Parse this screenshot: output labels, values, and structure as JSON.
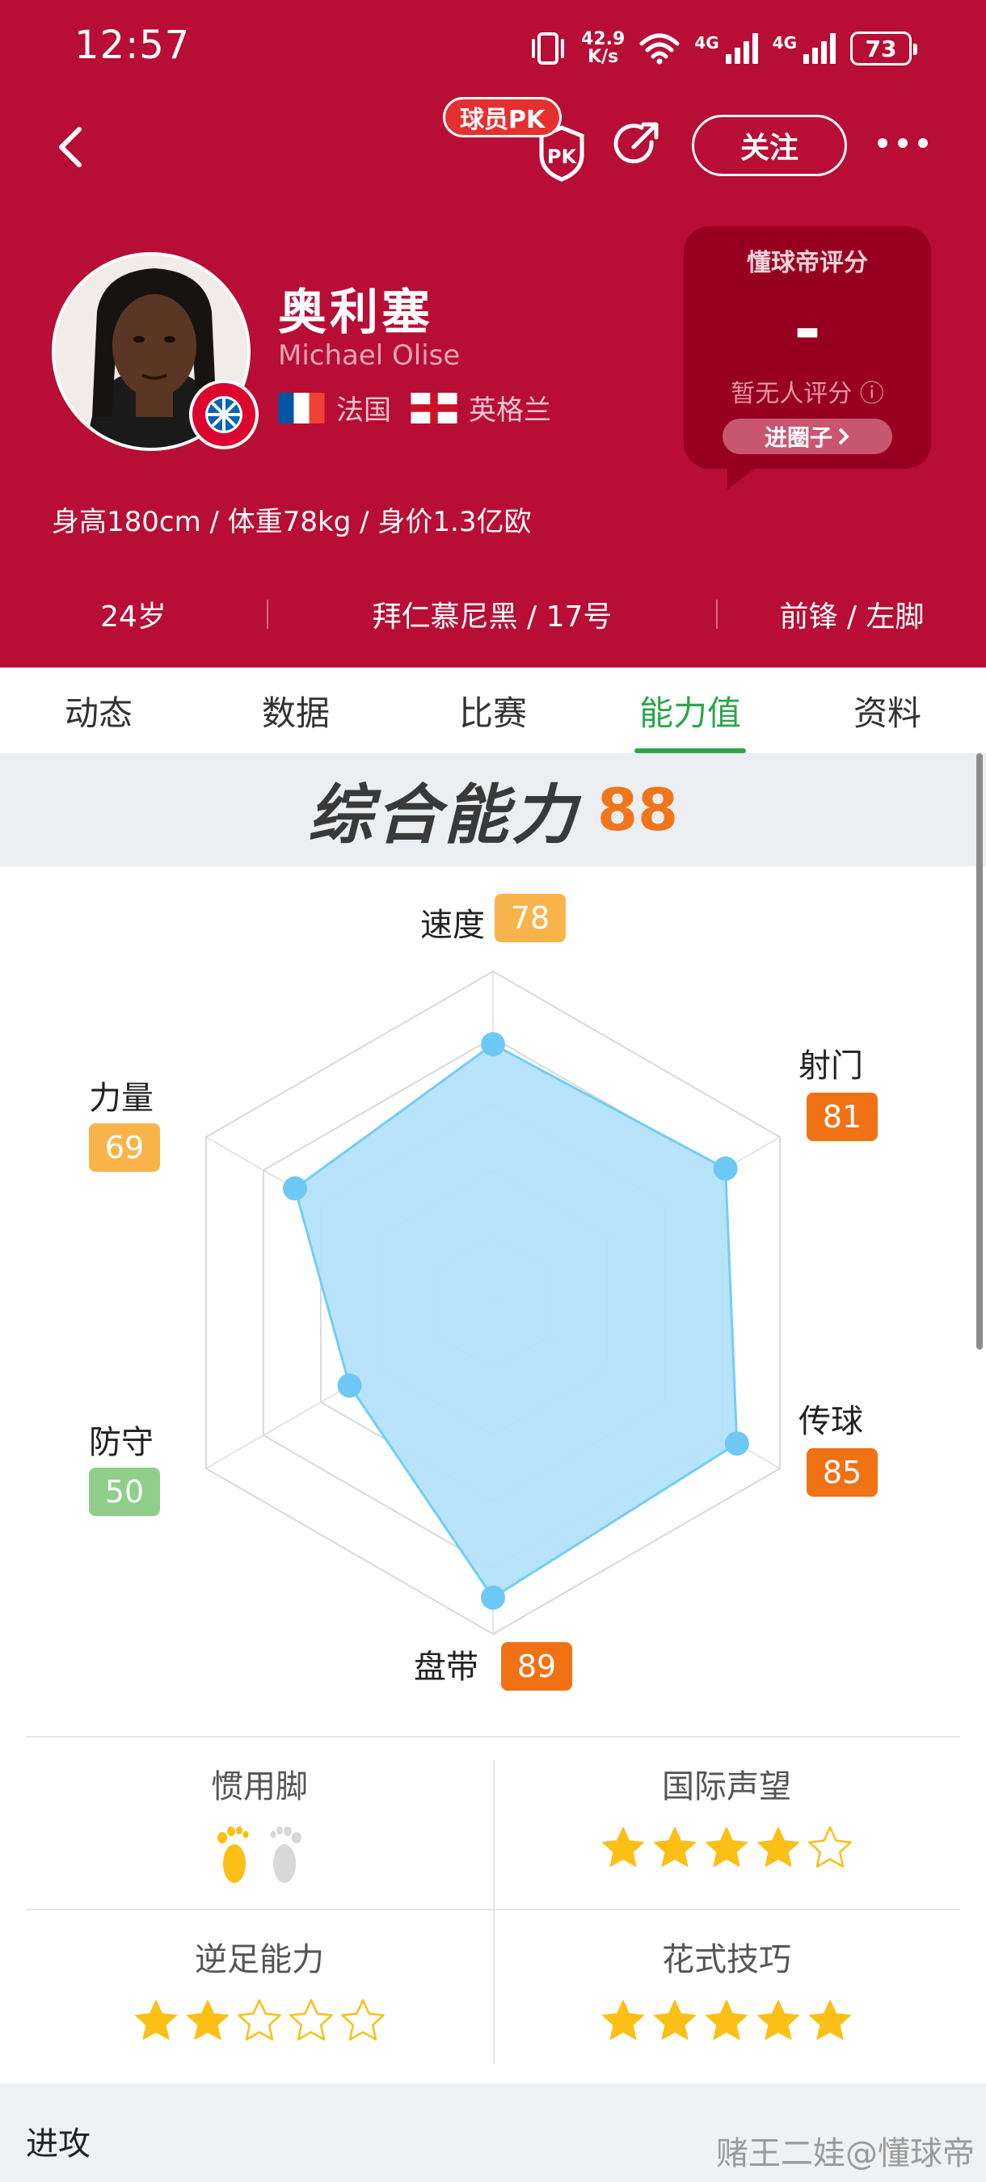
{
  "status_bar": {
    "time": "12:57",
    "net_speed": "42.9",
    "net_unit": "K/s",
    "signal1": "4G",
    "signal2": "4G",
    "battery": "73"
  },
  "nav": {
    "pk_badge": "球员PK",
    "pk_icon_label": "PK",
    "follow_label": "关注"
  },
  "player": {
    "name_cn": "奥利塞",
    "name_en": "Michael Olise",
    "nationality_1": "法国",
    "nationality_2": "英格兰",
    "body_info": "身高180cm / 体重78kg / 身价1.3亿欧",
    "age": "24岁",
    "club_number": "拜仁慕尼黑 / 17号",
    "position_foot": "前锋 / 左脚"
  },
  "rating_card": {
    "title": "懂球帝评分",
    "value": "-",
    "note": "暂无人评分",
    "info_icon": "ⓘ",
    "button": "进圈子"
  },
  "tabs": [
    {
      "label": "动态",
      "active": false
    },
    {
      "label": "数据",
      "active": false
    },
    {
      "label": "比赛",
      "active": false
    },
    {
      "label": "能力值",
      "active": true
    },
    {
      "label": "资料",
      "active": false
    }
  ],
  "overall": {
    "label": "综合能力",
    "value": "88"
  },
  "chart_data": {
    "type": "radar",
    "max": 100,
    "axes": [
      "速度",
      "射门",
      "传球",
      "盘带",
      "防守",
      "力量"
    ],
    "values": [
      78,
      81,
      85,
      89,
      50,
      69
    ],
    "badge_colors": [
      "#f8b44b",
      "#f07214",
      "#f07214",
      "#f07214",
      "#8fce8b",
      "#f8b44b"
    ],
    "fill_color": "#b3e3fa",
    "stroke_color": "#73cdf6",
    "point_color": "#6ec8f5"
  },
  "attributes": {
    "preferred_foot": {
      "title": "惯用脚",
      "left_foot": "active",
      "right_foot": "inactive"
    },
    "reputation": {
      "title": "国际声望",
      "stars": 4,
      "max": 5
    },
    "weak_foot": {
      "title": "逆足能力",
      "stars": 2,
      "max": 5
    },
    "skill_moves": {
      "title": "花式技巧",
      "stars": 5,
      "max": 5
    }
  },
  "section": {
    "title": "进攻"
  },
  "watermark": "赌王二娃@懂球帝",
  "colors": {
    "header_red": "#b80d35",
    "card_red": "#97001f",
    "active_tab": "#2aa64a",
    "overall_orange": "#f0751b",
    "star_yellow": "#fbbf16"
  }
}
